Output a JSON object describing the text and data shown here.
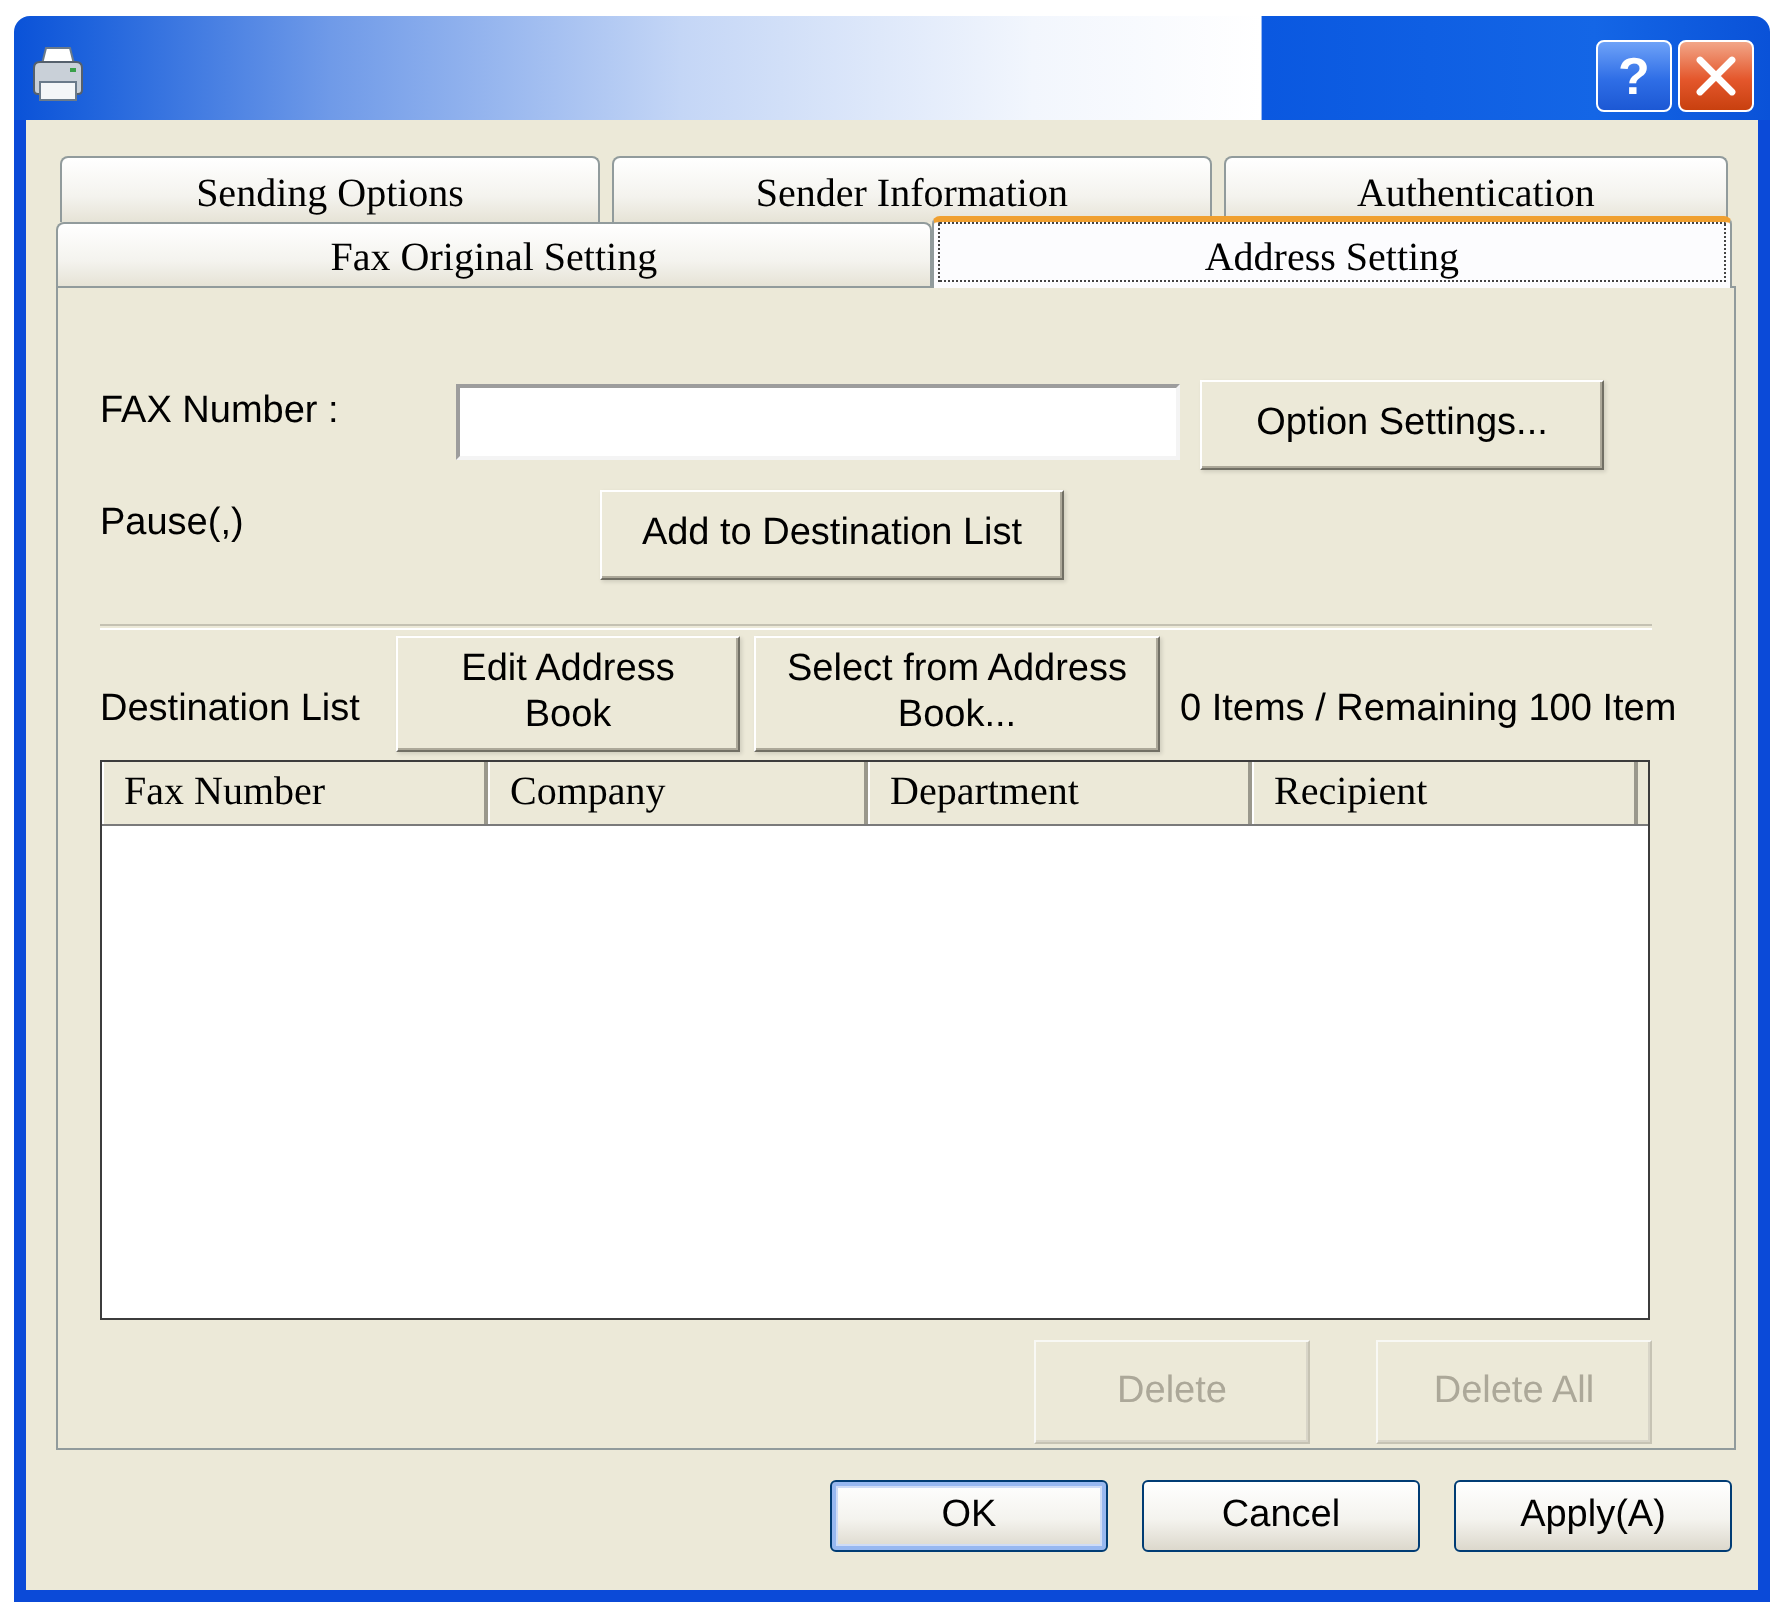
{
  "title_bar": {
    "help_button": "?"
  },
  "tabs": {
    "back_row": [
      {
        "label": "Sending Options",
        "selected": false
      },
      {
        "label": "Sender Information",
        "selected": false
      },
      {
        "label": "Authentication",
        "selected": false
      }
    ],
    "front_row": [
      {
        "label": "Fax Original Setting",
        "selected": false
      },
      {
        "label": "Address Setting",
        "selected": true
      }
    ]
  },
  "fax_number": {
    "label": "FAX Number :",
    "option_button": "Option Settings..."
  },
  "pause": {
    "label": "Pause(,)",
    "add_button": "Add to Destination List"
  },
  "destination": {
    "label": "Destination List",
    "buttons": [
      "Edit Address Book",
      "Select from Address Book..."
    ],
    "count": "0 Items / Remaining 100 Item"
  },
  "list": {
    "columns": [
      "Fax Number",
      "Company",
      "Department",
      "Recipient"
    ]
  },
  "delete_buttons": [
    {
      "label": "Delete",
      "disabled": true
    },
    {
      "label": "Delete All",
      "disabled": true
    }
  ],
  "dialog_buttons": [
    {
      "label": "OK",
      "default": true
    },
    {
      "label": "Cancel",
      "default": false
    },
    {
      "label": "Apply(A)",
      "default": false
    }
  ]
}
